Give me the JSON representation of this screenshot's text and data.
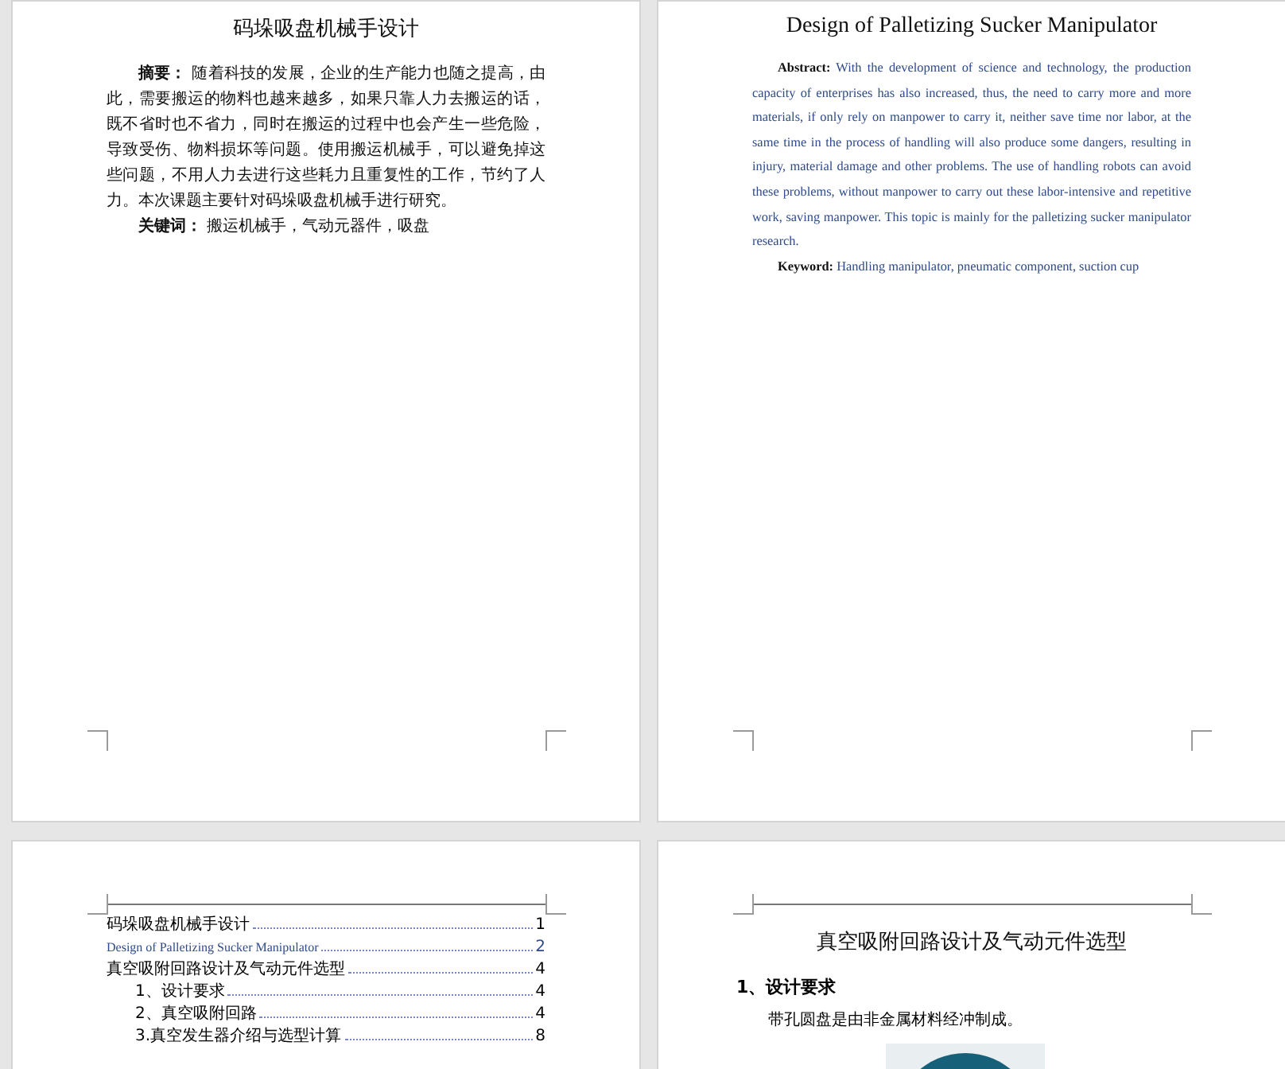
{
  "pages": [
    {
      "kind": "abstract_zh",
      "title": "码垛吸盘机械手设计",
      "abstract_label": "摘要：",
      "abstract_text": "随着科技的发展，企业的生产能力也随之提高，由此，需要搬运的物料也越来越多，如果只靠人力去搬运的话，既不省时也不省力，同时在搬运的过程中也会产生一些危险，导致受伤、物料损坏等问题。使用搬运机械手，可以避免掉这些问题，不用人力去进行这些耗力且重复性的工作，节约了人力。本次课题主要针对码垛吸盘机械手进行研究。",
      "keywords_label": "关键词：",
      "keywords_text": "搬运机械手，气动元器件，吸盘"
    },
    {
      "kind": "abstract_en",
      "title": "Design of Palletizing Sucker Manipulator",
      "abstract_label": "Abstract:",
      "abstract_text": "With the development of science and technology, the production capacity of enterprises has also increased, thus, the need to carry more and more materials, if only rely on manpower to carry it, neither save time nor labor, at the same time in the process of handling will also produce some dangers, resulting in injury, material damage and other problems. The use of handling robots can avoid these problems, without manpower to carry out these labor-intensive and repetitive work, saving manpower. This topic is mainly for the palletizing sucker manipulator research.",
      "keywords_label": "Keyword:",
      "keywords_text": "Handling manipulator, pneumatic component, suction cup"
    },
    {
      "kind": "toc",
      "entries": [
        {
          "text": "码垛吸盘机械手设计",
          "page": "1",
          "color": "#000000"
        },
        {
          "text": "Design of Palletizing Sucker Manipulator",
          "page": "2",
          "color": "#2e4a8a"
        },
        {
          "text": "真空吸附回路设计及气动元件选型",
          "page": "4",
          "color": "#000000",
          "children": [
            {
              "text": "1、设计要求",
              "page": "4",
              "color": "#000000"
            },
            {
              "text": "2、真空吸附回路",
              "page": "4",
              "color": "#000000"
            },
            {
              "text": "3.真空发生器介绍与选型计算",
              "page": "8",
              "color": "#000000"
            }
          ]
        }
      ]
    },
    {
      "kind": "chapter",
      "title": "真空吸附回路设计及气动元件选型",
      "heading": "1、设计要求",
      "body": "带孔圆盘是由非金属材料经冲制成。"
    }
  ]
}
